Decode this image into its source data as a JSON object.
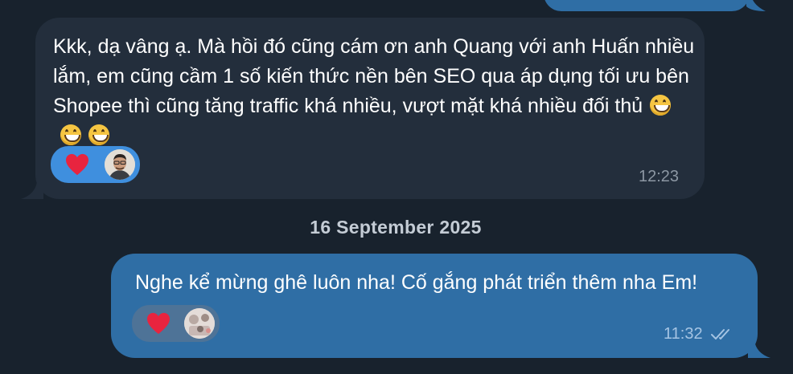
{
  "messages": [
    {
      "direction": "incoming",
      "text": "Kkk, dạ vâng ạ. Mà hồi đó cũng cám ơn anh Quang với anh Huấn nhiều lắm, em cũng cầm 1 số kiến thức nền bên SEO qua áp dụng tối ưu bên Shopee thì cũng tăng traffic khá nhiều, vượt mặt khá nhiều đối thủ",
      "emojis": [
        "grinning-face",
        "grinning-face",
        "grinning-face"
      ],
      "reaction": {
        "icon": "heart-icon",
        "color": "#e8243f",
        "bg": "#3f8fde"
      },
      "time": "12:23"
    },
    {
      "direction": "outgoing",
      "text": "Nghe kể mừng ghê luôn nha! Cố gắng phát triển thêm nha Em!",
      "reaction": {
        "icon": "heart-icon",
        "color": "#e8243f",
        "bg": "#4e7397"
      },
      "time": "11:32",
      "status": "double-check-read"
    }
  ],
  "date_separator": "16 September 2025",
  "colors": {
    "background": "#18222d",
    "incoming_bubble": "#232e3c",
    "outgoing_bubble": "#2f6ea5"
  }
}
